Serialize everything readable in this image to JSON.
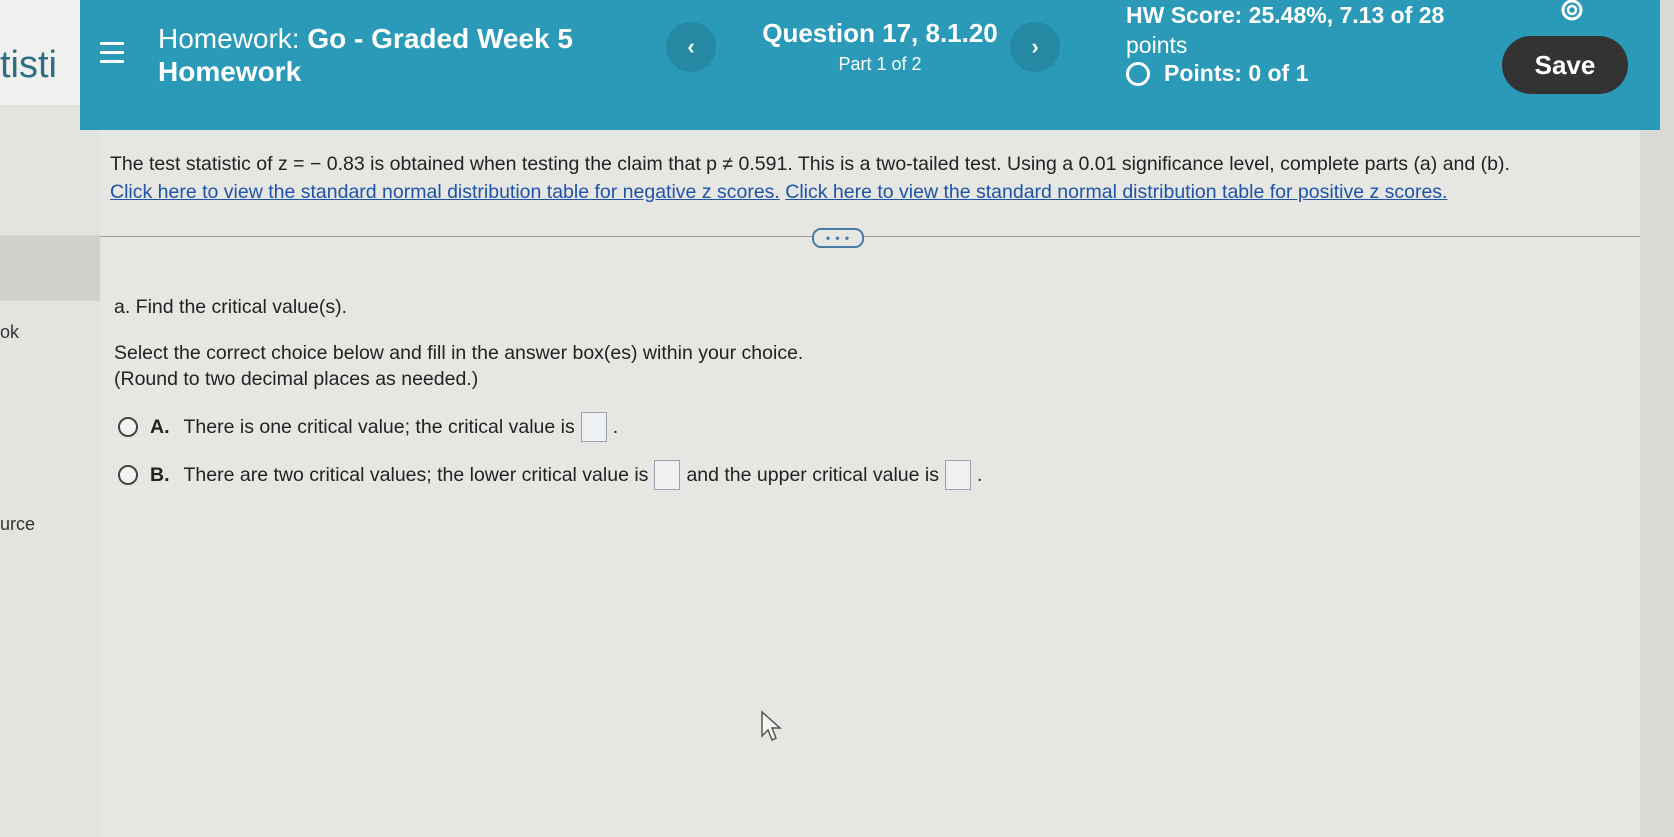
{
  "side": {
    "title": "tisti",
    "items": [
      "ok",
      "urce"
    ]
  },
  "header": {
    "hw_label": "Homework:",
    "hw_name_line1": "Go - Graded Week 5",
    "hw_name_line2": "Homework",
    "prev": "‹",
    "next": "›",
    "question_title": "Question 17, 8.1.20",
    "question_part": "Part 1 of 2",
    "hw_score_line1": "HW Score: 25.48%, 7.13 of 28",
    "hw_score_line2": "points",
    "points": "Points: 0 of 1",
    "save_label": "Save"
  },
  "question": {
    "intro": "The test statistic of z = − 0.83 is obtained when testing the claim that p ≠ 0.591. This is a two-tailed test. Using a 0.01 significance level, complete parts (a) and (b).",
    "link_negative": "Click here to view the standard normal distribution table for negative z scores.",
    "link_positive": "Click here to view the standard normal distribution table for positive z scores.",
    "expand_label": "• • •",
    "part_a": "a. Find the critical value(s).",
    "instruction": "Select the correct choice below and fill in the answer box(es) within your choice.",
    "rounding": "(Round to two decimal places as needed.)",
    "choice_a_letter": "A.",
    "choice_a_text": "There is one critical value; the critical value is",
    "choice_b_letter": "B.",
    "choice_b_text1": "There are two critical values; the lower critical value is",
    "choice_b_text2": "and the upper critical value is",
    "period": "."
  }
}
